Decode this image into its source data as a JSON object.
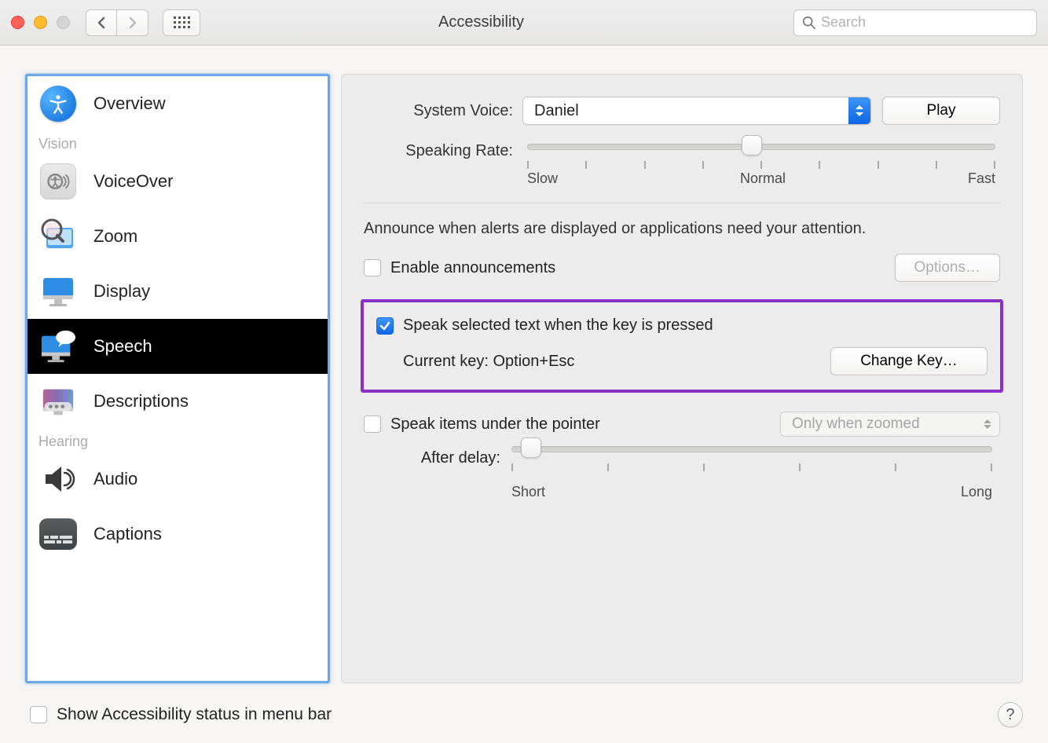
{
  "window": {
    "title": "Accessibility"
  },
  "search": {
    "placeholder": "Search"
  },
  "sidebar": {
    "top": {
      "overview": "Overview"
    },
    "visionHeader": "Vision",
    "vision": [
      {
        "label": "VoiceOver"
      },
      {
        "label": "Zoom"
      },
      {
        "label": "Display"
      },
      {
        "label": "Speech"
      },
      {
        "label": "Descriptions"
      }
    ],
    "hearingHeader": "Hearing",
    "hearing": [
      {
        "label": "Audio"
      },
      {
        "label": "Captions"
      }
    ]
  },
  "panel": {
    "systemVoiceLabel": "System Voice:",
    "systemVoiceValue": "Daniel",
    "playLabel": "Play",
    "speakingRateLabel": "Speaking Rate:",
    "rateTicks": {
      "slow": "Slow",
      "normal": "Normal",
      "fast": "Fast"
    },
    "announceDesc": "Announce when alerts are displayed or applications need your attention.",
    "enableAnnouncements": "Enable announcements",
    "optionsLabel": "Options…",
    "speakSelected": "Speak selected text when the key is pressed",
    "currentKeyLabel": "Current key: Option+Esc",
    "changeKeyLabel": "Change Key…",
    "speakPointer": "Speak items under the pointer",
    "pointerMode": "Only when zoomed",
    "afterDelayLabel": "After delay:",
    "delayTicks": {
      "short": "Short",
      "long": "Long"
    }
  },
  "footer": {
    "showStatus": "Show Accessibility status in menu bar"
  }
}
